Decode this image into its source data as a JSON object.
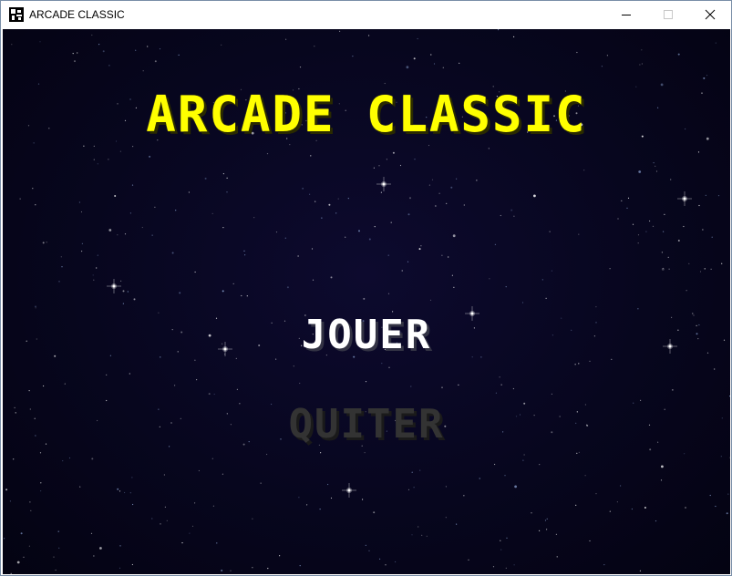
{
  "window": {
    "title": "ARCADE CLASSIC",
    "icon": "app-icon",
    "controls": [
      "minimize-icon",
      "maximize-icon",
      "close-icon"
    ]
  },
  "game": {
    "title": "ARCADE CLASSIC",
    "menu": [
      {
        "label": "JOUER",
        "state": "selected"
      },
      {
        "label": "QUITER",
        "state": "unselected"
      }
    ]
  },
  "colors": {
    "title": "#ffff00",
    "menu_selected": "#ffffff",
    "menu_unselected": "#333333",
    "background": "#07061e",
    "stars": "#ffffff"
  }
}
